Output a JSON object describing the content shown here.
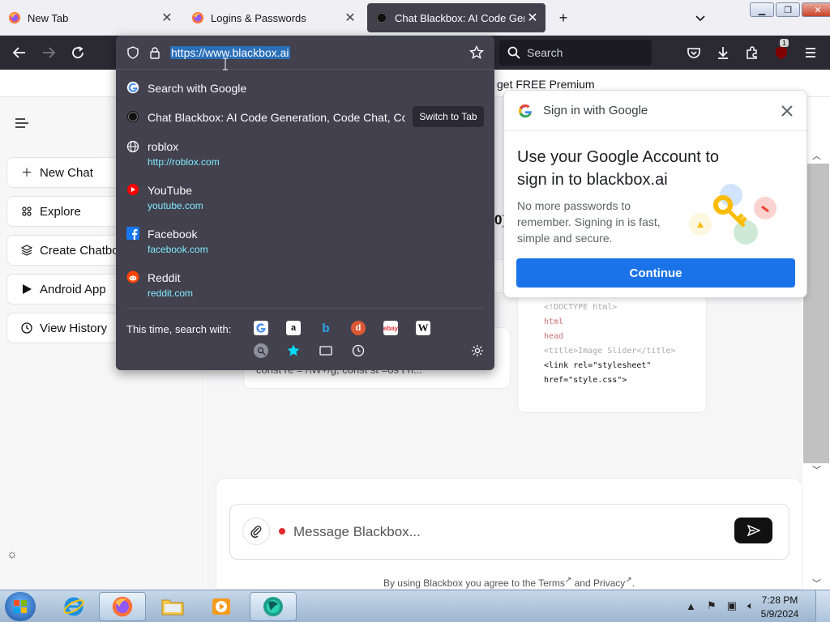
{
  "window": {
    "tabs": [
      {
        "title": "New Tab",
        "favicon": "firefox-icon"
      },
      {
        "title": "Logins & Passwords",
        "favicon": "firefox-icon"
      },
      {
        "title": "Chat Blackbox: AI Code Generat",
        "favicon": "blackbox-icon",
        "active": true
      }
    ],
    "new_tab": "+",
    "list_tabs": "⌄"
  },
  "toolbar": {
    "search_placeholder": "Search",
    "extensions_badge": "1"
  },
  "urlbar": {
    "url": "https://www.blackbox.ai",
    "search_with_google": "Search with Google",
    "switch_to_tab": "Switch to Tab",
    "suggestions": [
      {
        "title": "Chat Blackbox: AI Code Generation, Code Chat, Code",
        "url": "",
        "icon": "blackbox-icon"
      },
      {
        "title": "roblox",
        "url": "http://roblox.com",
        "icon": "globe-icon"
      },
      {
        "title": "YouTube",
        "url": "youtube.com",
        "icon": "youtube-icon"
      },
      {
        "title": "Facebook",
        "url": "facebook.com",
        "icon": "facebook-icon"
      },
      {
        "title": "Reddit",
        "url": "reddit.com",
        "icon": "reddit-icon"
      }
    ],
    "search_with_label": "This time, search with:"
  },
  "page": {
    "promo_text": "get FREE Premium",
    "sidebar": [
      {
        "label": "New Chat",
        "icon": "plus-icon"
      },
      {
        "label": "Explore",
        "icon": "grid-icon"
      },
      {
        "label": "Create Chatbo",
        "icon": "layers-icon"
      },
      {
        "label": "Android App",
        "icon": "play-icon"
      },
      {
        "label": "View History",
        "icon": "clock-icon"
      }
    ],
    "fragment_ox": "0)",
    "card_b_text": "const re = /\\W+/g, const st    =os t n...",
    "code_lines": [
      {
        "text": "<!DOCTYPE html>",
        "style": "fade"
      },
      {
        "text": " html",
        "style": "tag"
      },
      {
        "text": " head",
        "style": "tag"
      },
      {
        "text": "<title>Image Slider</title>",
        "style": "fade"
      },
      {
        "text": "<link rel=\"stylesheet\"",
        "style": "normal"
      },
      {
        "text": "href=\"style.css\">",
        "style": "normal"
      }
    ],
    "message_placeholder": "Message Blackbox...",
    "terms_text": "By using Blackbox you agree to the",
    "terms_link": "Terms",
    "and_text": "and",
    "privacy_link": "Privacy"
  },
  "google_popup": {
    "header": "Sign in with Google",
    "title": "Use your Google Account to sign in to blackbox.ai",
    "description": "No more passwords to remember. Signing in is fast, simple and secure.",
    "continue": "Continue"
  },
  "taskbar": {
    "time": "7:28 PM",
    "date": "5/9/2024"
  },
  "colors": {
    "firefox_dark": "#2b2a33",
    "panel": "#42414d",
    "url_cyan": "#80ebff",
    "google_blue": "#1a73e8"
  }
}
